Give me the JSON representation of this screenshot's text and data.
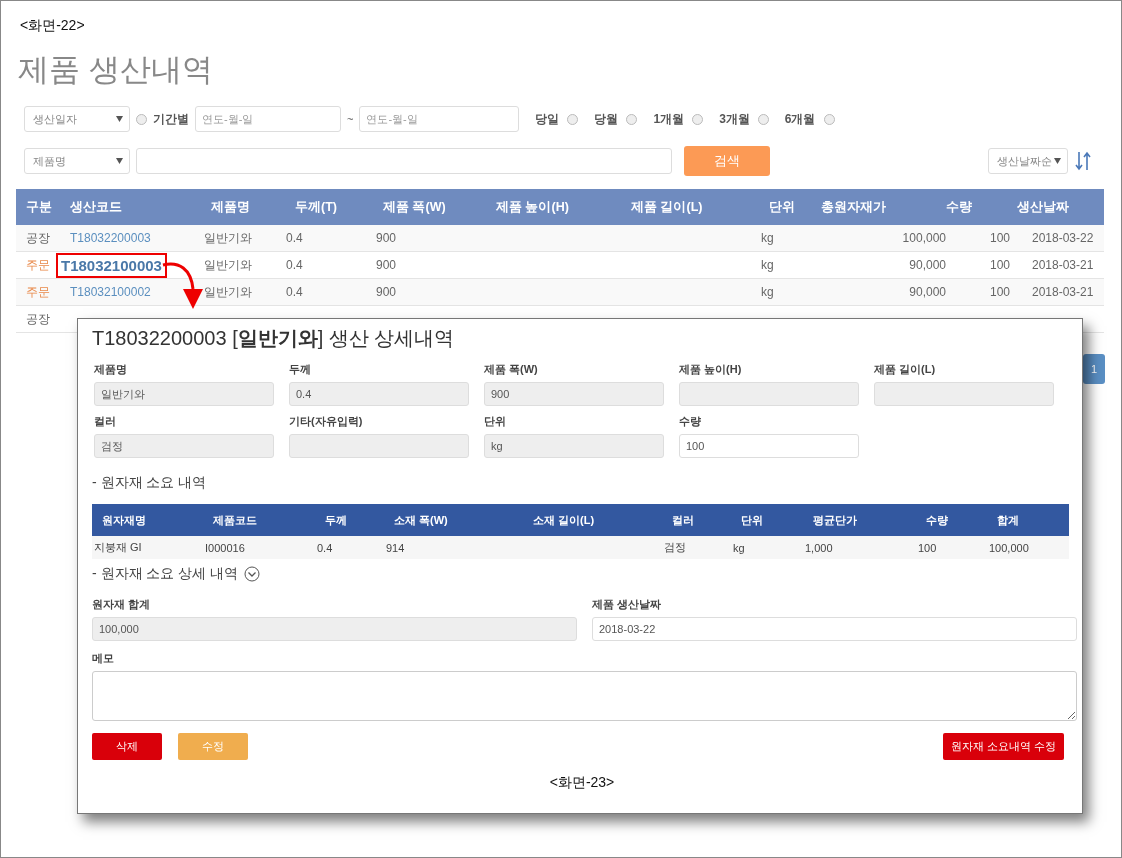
{
  "page_caption": "<화면-22>",
  "title": "제품 생산내역",
  "filters": {
    "date_type": {
      "value": "생산일자"
    },
    "period_radio": {
      "label": "기간별",
      "checked": false
    },
    "date_from": {
      "placeholder": "연도-월-일"
    },
    "range_separator": "~",
    "date_to": {
      "placeholder": "연도-월-일"
    },
    "quick_ranges": [
      {
        "label": "당일",
        "checked": false
      },
      {
        "label": "당월",
        "checked": false
      },
      {
        "label": "1개월",
        "checked": false
      },
      {
        "label": "3개월",
        "checked": false
      },
      {
        "label": "6개월",
        "checked": false
      }
    ],
    "field_select": {
      "value": "제품명"
    },
    "search_button": "검색",
    "sort_select": {
      "value": "생산날짜순"
    }
  },
  "table": {
    "columns": [
      "구분",
      "생산코드",
      "제품명",
      "두께(T)",
      "제품 폭(W)",
      "제품 높이(H)",
      "제품 길이(L)",
      "단위",
      "총원자재가",
      "수량",
      "생산날짜"
    ],
    "rows": [
      {
        "kind": "factory",
        "highlighted": false,
        "cells": [
          "공장",
          "T18032200003",
          "일반기와",
          "0.4",
          "900",
          null,
          null,
          "kg",
          "100,000",
          "100",
          "2018-03-22"
        ]
      },
      {
        "kind": "order",
        "highlighted": true,
        "cells": [
          "주문",
          "T18032100003",
          "일반기와",
          "0.4",
          "900",
          null,
          null,
          "kg",
          "90,000",
          "100",
          "2018-03-21"
        ]
      },
      {
        "kind": "order",
        "highlighted": false,
        "cells": [
          "주문",
          "T18032100002",
          "일반기와",
          "0.4",
          "900",
          null,
          null,
          "kg",
          "90,000",
          "100",
          "2018-03-21"
        ]
      },
      {
        "kind": "factory",
        "highlighted": false,
        "cells": [
          "공장",
          null,
          null,
          null,
          null,
          null,
          null,
          null,
          null,
          null,
          null
        ]
      }
    ]
  },
  "pagination": [
    {
      "label": "1",
      "selected": true
    }
  ],
  "detail_dialog": {
    "title": "T18032200003 [**일반기와**] 생산 상세내역",
    "fields": [
      {
        "label": "제품명",
        "value": "일반기와",
        "disabled": true
      },
      {
        "label": "두께",
        "value": "0.4",
        "disabled": true
      },
      {
        "label": "제품 폭(W)",
        "value": "900",
        "disabled": true
      },
      {
        "label": "제품 높이(H)",
        "disabled": true
      },
      {
        "label": "제품 길이(L)",
        "disabled": true
      },
      {
        "label": "컬러",
        "value": "검정",
        "disabled": true
      },
      {
        "label": "기타(자유입력)",
        "disabled": true
      },
      {
        "label": "단위",
        "value": "kg",
        "disabled": true
      },
      {
        "label": "수량",
        "value": "100",
        "disabled": false
      }
    ],
    "materials_heading": "- 원자재 소요 내역",
    "materials_table": {
      "columns": [
        "원자재명",
        "제품코드",
        "두께",
        "소재 폭(W)",
        "소재 길이(L)",
        "컬러",
        "단위",
        "평균단가",
        "수량",
        "합계"
      ],
      "rows": [
        [
          "지붕재 GI",
          "I000016",
          "0.4",
          "914",
          null,
          "검정",
          "kg",
          "1,000",
          "100",
          "100,000"
        ]
      ]
    },
    "details_heading": "- 원자재 소요 상세 내역",
    "details_expanded": false,
    "summary_fields": [
      {
        "label": "원자재 합계",
        "value": "100,000",
        "disabled": true
      },
      {
        "label": "제품 생산날짜",
        "value": "2018-03-22",
        "disabled": false
      }
    ],
    "memo": {
      "label": "메모"
    },
    "buttons": [
      {
        "label": "삭제",
        "kind": "danger"
      },
      {
        "label": "수정",
        "kind": "warning"
      },
      {
        "label": "원자재 소요내역 수정",
        "kind": "danger"
      }
    ],
    "caption": "<화면-23>"
  }
}
